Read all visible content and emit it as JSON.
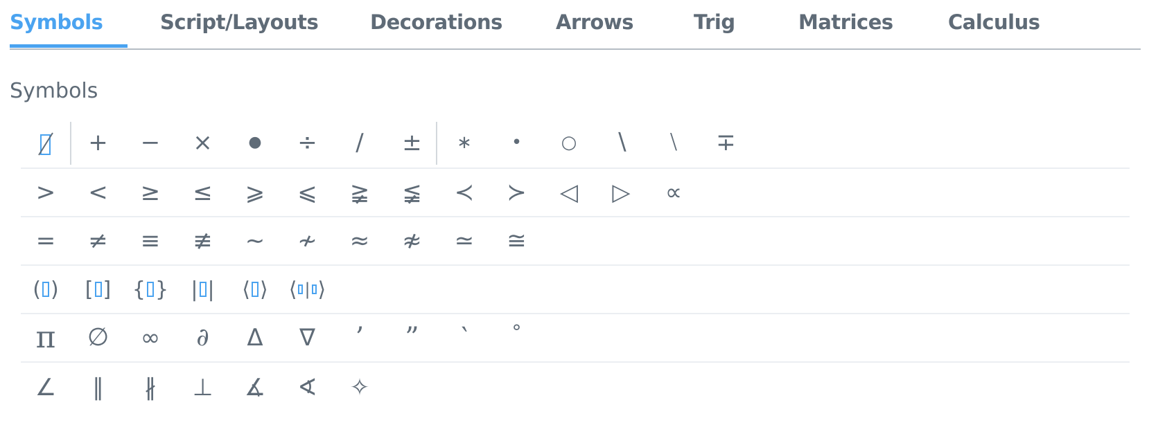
{
  "tabs": [
    {
      "label": "Symbols",
      "active": true
    },
    {
      "label": "Script/Layouts",
      "active": false
    },
    {
      "label": "Decorations",
      "active": false
    },
    {
      "label": "Arrows",
      "active": false
    },
    {
      "label": "Trig",
      "active": false
    },
    {
      "label": "Matrices",
      "active": false
    },
    {
      "label": "Calculus",
      "active": false
    }
  ],
  "colors": {
    "accent": "#4aa3f0",
    "text": "#5f6b77",
    "divider": "#ebeef2"
  },
  "section": {
    "title": "Symbols"
  },
  "rows": [
    {
      "name": "operators",
      "items": [
        {
          "name": "cancel",
          "glyph": ""
        },
        {
          "name": "plus",
          "glyph": "+"
        },
        {
          "name": "minus",
          "glyph": "−"
        },
        {
          "name": "times",
          "glyph": "×"
        },
        {
          "name": "bullet",
          "glyph": "●"
        },
        {
          "name": "divide",
          "glyph": "÷"
        },
        {
          "name": "slash",
          "glyph": "∕"
        },
        {
          "name": "plus-minus",
          "glyph": "±"
        },
        {
          "name": "asterisk",
          "glyph": "∗"
        },
        {
          "name": "dot",
          "glyph": "•"
        },
        {
          "name": "ring",
          "glyph": "○"
        },
        {
          "name": "backslash",
          "glyph": "∖"
        },
        {
          "name": "set-minus",
          "glyph": "⧵"
        },
        {
          "name": "minus-plus",
          "glyph": "∓"
        }
      ]
    },
    {
      "name": "relations",
      "items": [
        {
          "name": "greater-than",
          "glyph": ">"
        },
        {
          "name": "less-than",
          "glyph": "<"
        },
        {
          "name": "greater-equal",
          "glyph": "≥"
        },
        {
          "name": "less-equal",
          "glyph": "≤"
        },
        {
          "name": "greater-equal-slant",
          "glyph": "⩾"
        },
        {
          "name": "less-equal-slant",
          "glyph": "⩽"
        },
        {
          "name": "greater-not-equal",
          "glyph": "≩"
        },
        {
          "name": "less-not-equal",
          "glyph": "≨"
        },
        {
          "name": "precedes",
          "glyph": "≺"
        },
        {
          "name": "succeeds",
          "glyph": "≻"
        },
        {
          "name": "triangle-left",
          "glyph": "◁"
        },
        {
          "name": "triangle-right",
          "glyph": "▷"
        },
        {
          "name": "proportional",
          "glyph": "∝"
        }
      ]
    },
    {
      "name": "equivalence",
      "items": [
        {
          "name": "equals",
          "glyph": "="
        },
        {
          "name": "not-equals",
          "glyph": "≠"
        },
        {
          "name": "identical",
          "glyph": "≡"
        },
        {
          "name": "not-identical",
          "glyph": "≢"
        },
        {
          "name": "tilde",
          "glyph": "∼"
        },
        {
          "name": "not-tilde",
          "glyph": "≁"
        },
        {
          "name": "approx",
          "glyph": "≈"
        },
        {
          "name": "not-approx",
          "glyph": "≉"
        },
        {
          "name": "asymp-equal",
          "glyph": "≃"
        },
        {
          "name": "congruent",
          "glyph": "≅"
        }
      ]
    },
    {
      "name": "brackets",
      "items": [
        {
          "name": "parentheses",
          "open": "(",
          "close": ")",
          "slots": 1
        },
        {
          "name": "square-brackets",
          "open": "[",
          "close": "]",
          "slots": 1
        },
        {
          "name": "curly-braces",
          "open": "{",
          "close": "}",
          "slots": 1
        },
        {
          "name": "absolute-value",
          "open": "|",
          "close": "|",
          "slots": 1
        },
        {
          "name": "angle-brackets",
          "open": "⟨",
          "close": "⟩",
          "slots": 1
        },
        {
          "name": "bra-ket",
          "open": "⟨",
          "close": "⟩",
          "slots": 2
        }
      ]
    },
    {
      "name": "constants",
      "items": [
        {
          "name": "pi",
          "glyph": "π"
        },
        {
          "name": "empty-set",
          "glyph": "∅"
        },
        {
          "name": "infinity",
          "glyph": "∞"
        },
        {
          "name": "partial",
          "glyph": "∂"
        },
        {
          "name": "delta",
          "glyph": "Δ"
        },
        {
          "name": "nabla",
          "glyph": "∇"
        },
        {
          "name": "prime",
          "glyph": "’"
        },
        {
          "name": "double-prime",
          "glyph": "”"
        },
        {
          "name": "backprime",
          "glyph": "‵"
        },
        {
          "name": "degree",
          "glyph": "°"
        }
      ]
    },
    {
      "name": "geometry",
      "items": [
        {
          "name": "angle",
          "glyph": "∠"
        },
        {
          "name": "parallel",
          "glyph": "∥"
        },
        {
          "name": "not-parallel",
          "glyph": "∦"
        },
        {
          "name": "perpendicular",
          "glyph": "⊥"
        },
        {
          "name": "measured-angle",
          "glyph": "∡"
        },
        {
          "name": "spherical-angle",
          "glyph": "∢"
        },
        {
          "name": "diamond-star",
          "glyph": "✧"
        }
      ]
    }
  ]
}
